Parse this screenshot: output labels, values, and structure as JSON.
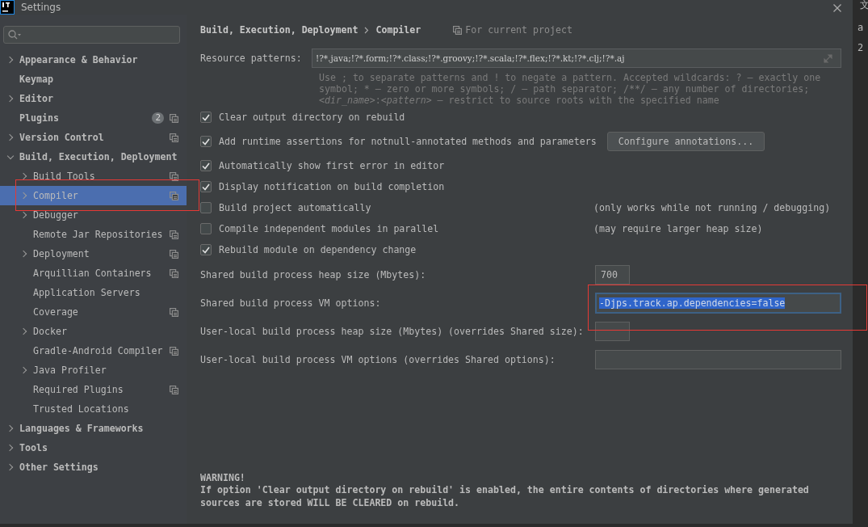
{
  "window": {
    "title": "Settings"
  },
  "sidebar": {
    "items": [
      {
        "label": "Appearance & Behavior",
        "expanded": false,
        "selected": false,
        "project_scope": false
      },
      {
        "label": "Keymap",
        "selected": false,
        "project_scope": false
      },
      {
        "label": "Editor",
        "expanded": false,
        "selected": false,
        "project_scope": false
      },
      {
        "label": "Plugins",
        "selected": false,
        "project_scope": true,
        "badge": "2"
      },
      {
        "label": "Version Control",
        "expanded": false,
        "selected": false,
        "project_scope": true
      },
      {
        "label": "Build, Execution, Deployment",
        "expanded": true,
        "selected": false,
        "project_scope": false,
        "children": [
          {
            "label": "Build Tools",
            "expanded": false,
            "selected": false,
            "project_scope": true
          },
          {
            "label": "Compiler",
            "expanded": false,
            "selected": true,
            "project_scope": true
          },
          {
            "label": "Debugger",
            "expanded": false,
            "selected": false,
            "project_scope": false
          },
          {
            "label": "Remote Jar Repositories",
            "selected": false,
            "project_scope": true
          },
          {
            "label": "Deployment",
            "expanded": false,
            "selected": false,
            "project_scope": true
          },
          {
            "label": "Arquillian Containers",
            "selected": false,
            "project_scope": true
          },
          {
            "label": "Application Servers",
            "selected": false,
            "project_scope": false
          },
          {
            "label": "Coverage",
            "selected": false,
            "project_scope": true
          },
          {
            "label": "Docker",
            "expanded": false,
            "selected": false,
            "project_scope": false
          },
          {
            "label": "Gradle-Android Compiler",
            "selected": false,
            "project_scope": true
          },
          {
            "label": "Java Profiler",
            "expanded": false,
            "selected": false,
            "project_scope": false
          },
          {
            "label": "Required Plugins",
            "selected": false,
            "project_scope": true
          },
          {
            "label": "Trusted Locations",
            "selected": false,
            "project_scope": false
          }
        ]
      },
      {
        "label": "Languages & Frameworks",
        "expanded": false,
        "selected": false,
        "project_scope": false
      },
      {
        "label": "Tools",
        "expanded": false,
        "selected": false,
        "project_scope": false
      },
      {
        "label": "Other Settings",
        "expanded": false,
        "selected": false,
        "project_scope": false
      }
    ]
  },
  "main": {
    "breadcrumb": [
      "Build, Execution, Deployment",
      "Compiler"
    ],
    "scope_note": "For current project",
    "resource_patterns": {
      "label": "Resource patterns:",
      "value": "!?*.java;!?*.form;!?*.class;!?*.groovy;!?*.scala;!?*.flex;!?*.kt;!?*.clj;!?*.aj",
      "hint": [
        "Use ; to separate patterns and ! to negate a pattern. Accepted wildcards: ? — exactly one",
        "symbol; * — zero or more symbols; / — path separator; /**/ — any number of directories;",
        "*<dir_name>*:*<pattern>* — restrict to source roots with the specified name"
      ]
    },
    "options": [
      {
        "label": "Clear output directory on rebuild",
        "checked": true
      },
      {
        "label": "Add runtime assertions for notnull-annotated methods and parameters",
        "checked": true,
        "button": "Configure annotations..."
      },
      {
        "label": "Automatically show first error in editor",
        "checked": true
      },
      {
        "label": "Display notification on build completion",
        "checked": true
      },
      {
        "label": "Build project automatically",
        "checked": false,
        "note": "(only works while not running / debugging)"
      },
      {
        "label": "Compile independent modules in parallel",
        "checked": false,
        "note": "(may require larger heap size)"
      },
      {
        "label": "Rebuild module on dependency change",
        "checked": true
      }
    ],
    "fields": [
      {
        "label": "Shared build process heap size (Mbytes):",
        "kind": "short",
        "value": "700",
        "focused": false
      },
      {
        "label": "Shared build process VM options:",
        "kind": "wide",
        "value": "-Djps.track.ap.dependencies=false",
        "focused": true
      },
      {
        "label": "User-local build process heap size (Mbytes) (overrides Shared size):",
        "kind": "short",
        "focused": false
      },
      {
        "label": "User-local build process VM options (overrides Shared options):",
        "kind": "wide",
        "focused": false
      }
    ],
    "warning": {
      "title": "WARNING!",
      "text": "If option 'Clear output directory on rebuild' is enabled, the entire contents of directories where generated sources are stored WILL BE CLEARED on rebuild."
    }
  },
  "annotations": {
    "sidebar_frame": true,
    "vm_field_frame": true
  },
  "background_window": {
    "texts": [
      "文",
      "a",
      "2"
    ]
  }
}
